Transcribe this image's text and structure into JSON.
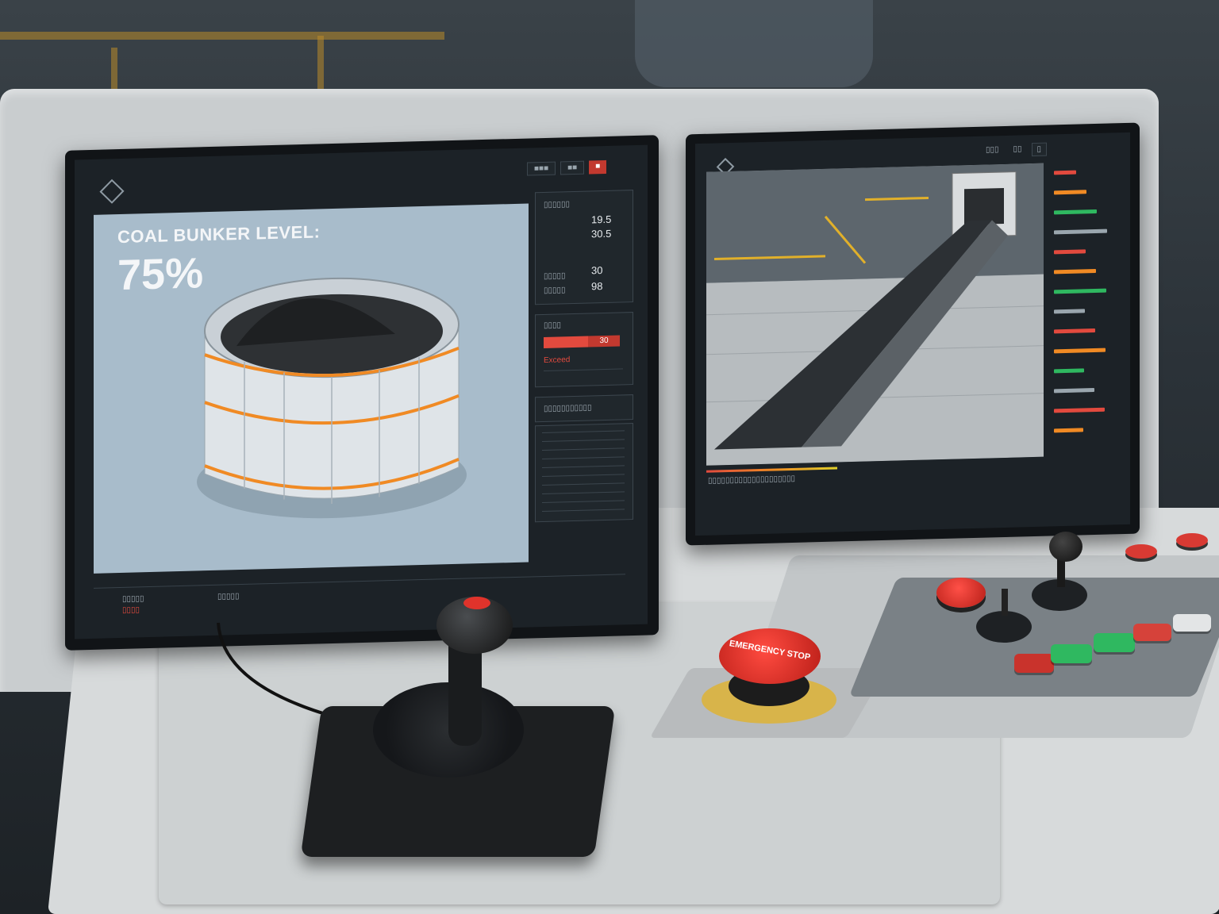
{
  "left_monitor": {
    "header_buttons": [
      "■■■",
      "■■",
      "■"
    ],
    "bunker_title": "COAL BUNKER LEVEL:",
    "bunker_level": "75%",
    "level_percent": 75,
    "readouts_top": [
      {
        "label": "▯▯▯▯▯▯",
        "value": "19.5"
      },
      {
        "label": "",
        "value": "30.5"
      }
    ],
    "readouts_mid": [
      {
        "label": "▯▯▯▯▯",
        "value": "30"
      },
      {
        "label": "▯▯▯▯▯",
        "value": "98"
      }
    ],
    "alarm_section_label": "▯▯▯▯",
    "alarm_value": "30",
    "alarm_status": "Exceed",
    "table_header": "▯▯▯▯▯▯▯▯▯▯▯",
    "table_rows": 10,
    "footer_left": "▯▯▯▯▯",
    "footer_sub": "▯▯▯▯",
    "footer_mid": "▯▯▯▯▯"
  },
  "right_monitor": {
    "header_buttons": [
      "▯▯▯",
      "▯▯",
      "▯"
    ],
    "feed_caption": "▯▯▯▯▯▯▯▯▯▯▯▯▯▯▯▯▯▯▯▯",
    "side_rows": 14
  },
  "desk": {
    "emergency_stop_label": "EMERGENCY STOP"
  },
  "colors": {
    "alarm_red": "#e24a3e",
    "accent_orange": "#f08a24",
    "status_green": "#2fb860",
    "bunker_bg": "#a8bccb"
  }
}
